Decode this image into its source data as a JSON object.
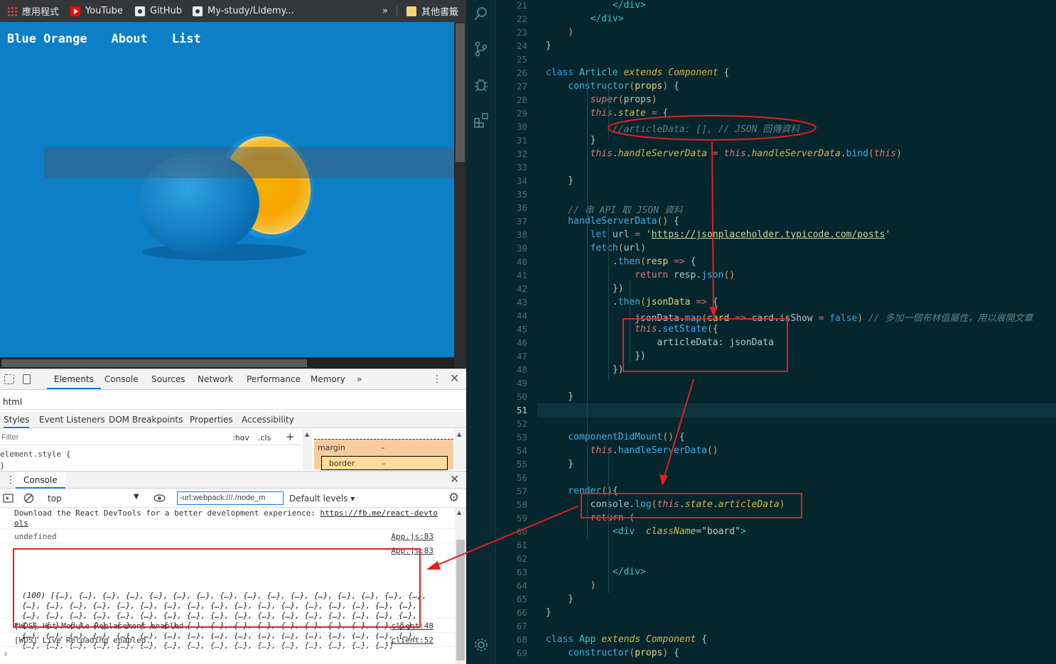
{
  "bookmarks": {
    "items": [
      {
        "label": "應用程式",
        "icon": "apps-icon"
      },
      {
        "label": "YouTube",
        "icon": "youtube-icon"
      },
      {
        "label": "GitHub",
        "icon": "github-icon"
      },
      {
        "label": "My-study/Lidemy...",
        "icon": "github-icon"
      }
    ],
    "more": "»",
    "other": "其他書籤"
  },
  "site": {
    "nav": [
      "Blue Orange",
      "About",
      "List"
    ]
  },
  "devtools": {
    "tabs": [
      "Elements",
      "Console",
      "Sources",
      "Network",
      "Performance",
      "Memory",
      "»"
    ],
    "active_tab": "Elements",
    "breadcrumb": "html",
    "sub_tabs": [
      "Styles",
      "Event Listeners",
      "DOM Breakpoints",
      "Properties",
      "Accessibility"
    ],
    "filter_placeholder": "Filter",
    "hov": ":hov",
    "cls": ".cls",
    "add": "+",
    "element_style_open": "element.style {",
    "element_style_close": "}",
    "box_model": {
      "margin": "margin",
      "margin_val": "–",
      "border": "border",
      "border_val": "–"
    },
    "drawer_tab": "Console",
    "context": "top",
    "console_filter": "-url:webpack:///./node_m",
    "levels": "Default levels ▾",
    "messages": [
      {
        "text": "Download the React DevTools for a better development experience: ",
        "link": "https://fb.me/react-devtools",
        "link_a": "https://fb.me/react-devto",
        "link_b": "ols"
      },
      {
        "text": "undefined",
        "source": "App.js:83"
      },
      {
        "source": "App.js:83",
        "array": "(100) [{…}, {…}, {…}, {…}, {…}, {…}, {…}, {…}, {…}, {…}, {…}, {…}, {…}, {…}, {…}, {…},\n{…}, {…}, {…}, {…}, {…}, {…}, {…}, {…}, {…}, {…}, {…}, {…}, {…}, {…}, {…}, {…}, {…},\n{…}, {…}, {…}, {…}, {…}, {…}, {…}, {…}, {…}, {…}, {…}, {…}, {…}, {…}, {…}, {…}, {…},\n{…}, {…}, {…}, {…}, {…}, {…}, {…}, {…}, {…}, {…}, {…}, {…}, {…}, {…}, {…}, {…}, {…},\n{…}, {…}, {…}, {…}, {…}, {…}, {…}, {…}, {…}, {…}, {…}, {…}, {…}, {…}, {…}, {…}, {…},\n{…}, {…}, {…}, {…}, {…}, {…}, {…}, {…}, {…}, {…}, {…}, {…}, {…}, {…}, {…}, {…}]"
      },
      {
        "text": "[WDS] Hot Module Replacement enabled.",
        "source": "client:48"
      },
      {
        "text": "[WDS] Live Reloading enabled.",
        "source": "client:52"
      }
    ],
    "prompt": "›"
  },
  "editor": {
    "first_line": 21,
    "current_line": 51,
    "lines": [
      [
        [
          "t-tag",
          "            </div>"
        ]
      ],
      [
        [
          "t-tag",
          "        </div>"
        ]
      ],
      [
        [
          "t-par",
          "    )"
        ]
      ],
      [
        [
          "t-txt",
          "}"
        ]
      ],
      [],
      [
        [
          "t-kw",
          "class "
        ],
        [
          "t-cls",
          "Article "
        ],
        [
          "t-ext",
          "extends "
        ],
        [
          "t-comp",
          "Component "
        ],
        [
          "t-txt",
          "{"
        ]
      ],
      [
        [
          "t-fn",
          "    constructor"
        ],
        [
          "t-par",
          "("
        ],
        [
          "t-var",
          "props"
        ],
        [
          "t-par",
          ") "
        ],
        [
          "t-txt",
          "{"
        ]
      ],
      [
        [
          "t-this",
          "        super"
        ],
        [
          "t-par",
          "("
        ],
        [
          "t-txt",
          "props"
        ],
        [
          "t-par",
          ")"
        ]
      ],
      [
        [
          "t-this",
          "        this"
        ],
        [
          "t-txt",
          "."
        ],
        [
          "t-prop",
          "state "
        ],
        [
          "t-op",
          "= "
        ],
        [
          "t-txt",
          "{"
        ]
      ],
      [
        [
          "t-com",
          "            //articleData: [], // JSON 回傳資料"
        ]
      ],
      [
        [
          "t-txt",
          "        }"
        ]
      ],
      [
        [
          "t-this",
          "        this"
        ],
        [
          "t-txt",
          "."
        ],
        [
          "t-prop",
          "handleServerData "
        ],
        [
          "t-op",
          "= "
        ],
        [
          "t-this",
          "this"
        ],
        [
          "t-txt",
          "."
        ],
        [
          "t-prop",
          "handleServerData"
        ],
        [
          "t-txt",
          "."
        ],
        [
          "t-fn",
          "bind"
        ],
        [
          "t-par",
          "("
        ],
        [
          "t-this",
          "this"
        ],
        [
          "t-par",
          ")"
        ]
      ],
      [],
      [
        [
          "t-txt",
          "    }"
        ]
      ],
      [],
      [
        [
          "t-com",
          "    // 串 API 取 JSON 資料"
        ]
      ],
      [
        [
          "t-fn",
          "    handleServerData"
        ],
        [
          "t-par",
          "() "
        ],
        [
          "t-txt",
          "{"
        ]
      ],
      [
        [
          "t-kw",
          "        let "
        ],
        [
          "t-txt",
          "url "
        ],
        [
          "t-op",
          "= "
        ],
        [
          "t-str",
          "'"
        ],
        [
          "t-url",
          "https://jsonplaceholder.typicode.com/posts"
        ],
        [
          "t-str",
          "'"
        ]
      ],
      [
        [
          "t-fn",
          "        fetch"
        ],
        [
          "t-par",
          "("
        ],
        [
          "t-txt",
          "url"
        ],
        [
          "t-par",
          ")"
        ]
      ],
      [
        [
          "t-txt",
          "            ."
        ],
        [
          "t-fn",
          "then"
        ],
        [
          "t-par",
          "("
        ],
        [
          "t-var",
          "resp "
        ],
        [
          "t-op",
          "=> "
        ],
        [
          "t-txt",
          "{"
        ]
      ],
      [
        [
          "t-ret",
          "                return "
        ],
        [
          "t-txt",
          "resp."
        ],
        [
          "t-fn",
          "json"
        ],
        [
          "t-par",
          "()"
        ]
      ],
      [
        [
          "t-txt",
          "            })"
        ]
      ],
      [
        [
          "t-txt",
          "            ."
        ],
        [
          "t-fn",
          "then"
        ],
        [
          "t-par",
          "("
        ],
        [
          "t-var",
          "jsonData "
        ],
        [
          "t-op",
          "=> "
        ],
        [
          "t-txt",
          "{"
        ]
      ],
      [
        [
          "t-txt",
          "                jsonData."
        ],
        [
          "t-fn",
          "map"
        ],
        [
          "t-par",
          "("
        ],
        [
          "t-var",
          "card "
        ],
        [
          "t-op",
          "=> "
        ],
        [
          "t-txt",
          "card.isShow "
        ],
        [
          "t-op",
          "= "
        ],
        [
          "t-bool",
          "false"
        ],
        [
          "t-par",
          ") "
        ],
        [
          "t-com",
          "// 多加一個布林值屬性，用以展開文章"
        ]
      ],
      [
        [
          "t-this",
          "                this"
        ],
        [
          "t-txt",
          "."
        ],
        [
          "t-fn",
          "setState"
        ],
        [
          "t-par",
          "("
        ],
        [
          "t-txt",
          "{"
        ]
      ],
      [
        [
          "t-txt",
          "                    articleData: jsonData"
        ]
      ],
      [
        [
          "t-txt",
          "                })"
        ]
      ],
      [
        [
          "t-txt",
          "            })"
        ]
      ],
      [],
      [
        [
          "t-txt",
          "    }"
        ]
      ],
      [],
      [],
      [
        [
          "t-fn",
          "    componentDidMount"
        ],
        [
          "t-par",
          "() "
        ],
        [
          "t-txt",
          "{"
        ]
      ],
      [
        [
          "t-this",
          "        this"
        ],
        [
          "t-txt",
          "."
        ],
        [
          "t-fn",
          "handleServerData"
        ],
        [
          "t-par",
          "()"
        ]
      ],
      [
        [
          "t-txt",
          "    }"
        ]
      ],
      [],
      [
        [
          "t-fn",
          "    render"
        ],
        [
          "t-par",
          "()"
        ],
        [
          "t-txt",
          "{"
        ]
      ],
      [
        [
          "t-txt",
          "        console."
        ],
        [
          "t-fn",
          "log"
        ],
        [
          "t-par",
          "("
        ],
        [
          "t-this",
          "this"
        ],
        [
          "t-txt",
          "."
        ],
        [
          "t-prop",
          "state"
        ],
        [
          "t-txt",
          "."
        ],
        [
          "t-prop",
          "articleData"
        ],
        [
          "t-par",
          ")"
        ]
      ],
      [
        [
          "t-ret",
          "        return "
        ],
        [
          "t-par",
          "("
        ]
      ],
      [
        [
          "t-tag",
          "            <div  "
        ],
        [
          "t-attr",
          "className"
        ],
        [
          "t-txt",
          "="
        ],
        [
          "t-str",
          "\"board\""
        ],
        [
          "t-tag",
          ">"
        ]
      ],
      [],
      [],
      [
        [
          "t-tag",
          "            </div>"
        ]
      ],
      [
        [
          "t-par",
          "        )"
        ]
      ],
      [
        [
          "t-txt",
          "    }"
        ]
      ],
      [
        [
          "t-txt",
          "}"
        ]
      ],
      [],
      [
        [
          "t-kw",
          "class "
        ],
        [
          "t-cls",
          "App "
        ],
        [
          "t-ext",
          "extends "
        ],
        [
          "t-comp",
          "Component "
        ],
        [
          "t-txt",
          "{"
        ]
      ],
      [
        [
          "t-fn",
          "    constructor"
        ],
        [
          "t-par",
          "("
        ],
        [
          "t-var",
          "props"
        ],
        [
          "t-par",
          ") "
        ],
        [
          "t-txt",
          "{"
        ]
      ]
    ]
  },
  "colors": {
    "annotation": "#e02020",
    "site_bg": "#0f7fc7",
    "editor_bg": "#06262e"
  }
}
